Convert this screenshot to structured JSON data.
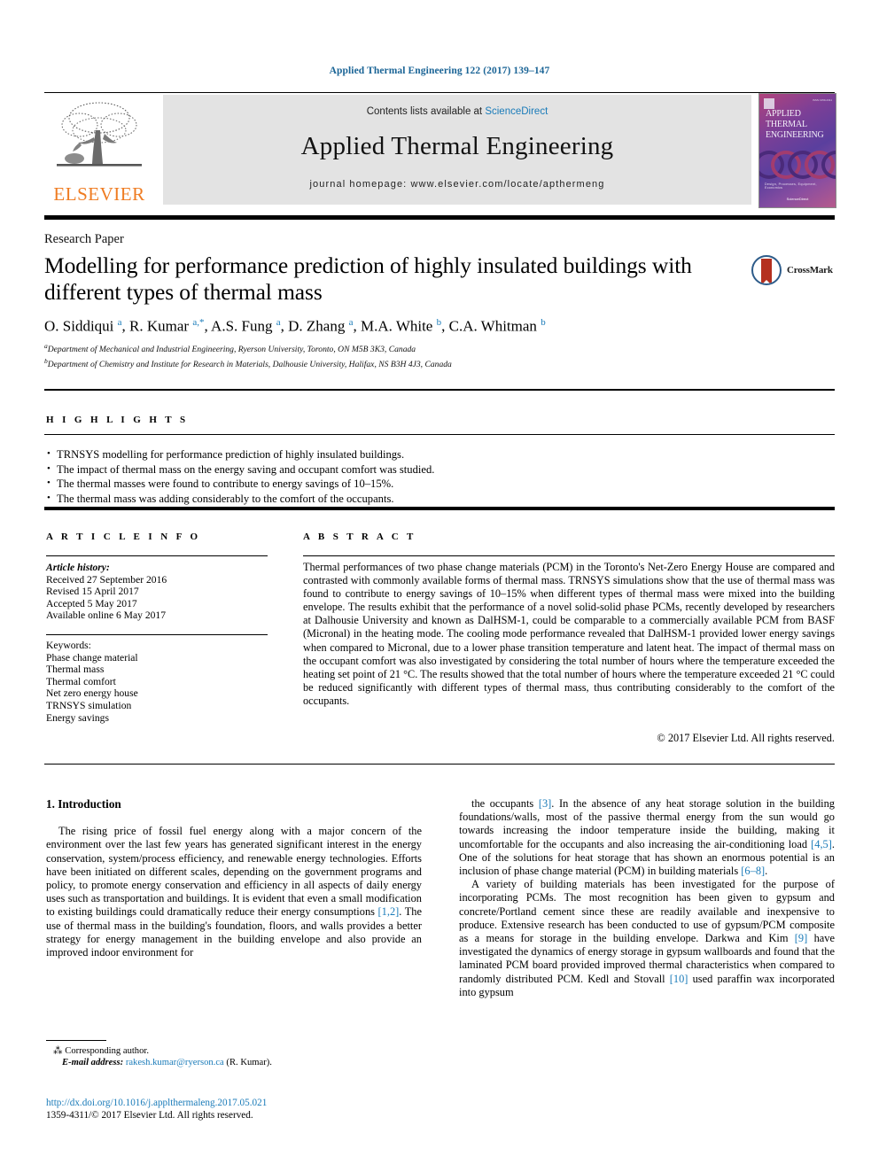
{
  "running_head": "Applied Thermal Engineering 122 (2017) 139–147",
  "masthead": {
    "publisher": "ELSEVIER",
    "contents_prefix": "Contents lists available at ",
    "contents_link": "ScienceDirect",
    "journal_title": "Applied Thermal Engineering",
    "homepage": "journal homepage: www.elsevier.com/locate/apthermeng",
    "cover": {
      "line1": "APPLIED",
      "line2": "THERMAL",
      "line3": "ENGINEERING",
      "footer_small": "Design, Processes, Equipment, Economics",
      "footer_brand": "ScienceDirect",
      "bg_start": "#b0437c",
      "bg_end": "#b65a8b"
    }
  },
  "article": {
    "kicker": "Research Paper",
    "title": "Modelling for performance prediction of highly insulated buildings with different types of thermal mass",
    "crossmark_label": "CrossMark",
    "authors_html": "O. Siddiqui <sup class=\"au-sup\">a</sup>, R. Kumar <sup class=\"au-sup\">a,*</sup>, A.S. Fung <sup class=\"au-sup\">a</sup>, D. Zhang <sup class=\"au-sup\">a</sup>, M.A. White <sup class=\"au-sup\">b</sup>, C.A. Whitman <sup class=\"au-sup\">b</sup>",
    "affiliations": [
      {
        "sup": "a",
        "text": "Department of Mechanical and Industrial Engineering, Ryerson University, Toronto, ON M5B 3K3, Canada"
      },
      {
        "sup": "b",
        "text": "Department of Chemistry and Institute for Research in Materials, Dalhousie University, Halifax, NS B3H 4J3, Canada"
      }
    ]
  },
  "highlights": {
    "label": "H I G H L I G H T S",
    "items": [
      "TRNSYS modelling for performance prediction of highly insulated buildings.",
      "The impact of thermal mass on the energy saving and occupant comfort was studied.",
      "The thermal masses were found to contribute to energy savings of 10–15%.",
      "The thermal mass was adding considerably to the comfort of the occupants."
    ]
  },
  "article_info": {
    "label": "A R T I C L E    I N F O",
    "history_label": "Article history:",
    "history": [
      "Received 27 September 2016",
      "Revised 15 April 2017",
      "Accepted 5 May 2017",
      "Available online 6 May 2017"
    ],
    "keywords_label": "Keywords:",
    "keywords": [
      "Phase change material",
      "Thermal mass",
      "Thermal comfort",
      "Net zero energy house",
      "TRNSYS simulation",
      "Energy savings"
    ]
  },
  "abstract": {
    "label": "A B S T R A C T",
    "text": "Thermal performances of two phase change materials (PCM) in the Toronto's Net-Zero Energy House are compared and contrasted with commonly available forms of thermal mass. TRNSYS simulations show that the use of thermal mass was found to contribute to energy savings of 10–15% when different types of thermal mass were mixed into the building envelope. The results exhibit that the performance of a novel solid-solid phase PCMs, recently developed by researchers at Dalhousie University and known as DalHSM-1, could be comparable to a commercially available PCM from BASF (Micronal) in the heating mode. The cooling mode performance revealed that DalHSM-1 provided lower energy savings when compared to Micronal, due to a lower phase transition temperature and latent heat. The impact of thermal mass on the occupant comfort was also investigated by considering the total number of hours where the temperature exceeded the heating set point of 21 °C. The results showed that the total number of hours where the temperature exceeded 21 °C could be reduced significantly with different types of thermal mass, thus contributing considerably to the comfort of the occupants.",
    "copyright": "© 2017 Elsevier Ltd. All rights reserved."
  },
  "body": {
    "section_heading": "1. Introduction",
    "left_paragraphs": [
      "The rising price of fossil fuel energy along with a major concern of the environment over the last few years has generated significant interest in the energy conservation, system/process efficiency, and renewable energy technologies. Efforts have been initiated on different scales, depending on the government programs and policy, to promote energy conservation and efficiency in all aspects of daily energy uses such as transportation and buildings. It is evident that even a small modification to existing buildings could dramatically reduce their energy consumptions [1,2]. The use of thermal mass in the building's foundation, floors, and walls provides a better strategy for energy management in the building envelope and also provide an improved indoor environment for"
    ],
    "right_paragraphs": [
      "the occupants [3]. In the absence of any heat storage solution in the building foundations/walls, most of the passive thermal energy from the sun would go towards increasing the indoor temperature inside the building, making it uncomfortable for the occupants and also increasing the air-conditioning load [4,5]. One of the solutions for heat storage that has shown an enormous potential is an inclusion of phase change material (PCM) in building materials [6–8].",
      "A variety of building materials has been investigated for the purpose of incorporating PCMs. The most recognition has been given to gypsum and concrete/Portland cement since these are readily available and inexpensive to produce. Extensive research has been conducted to use of gypsum/PCM composite as a means for storage in the building envelope. Darkwa and Kim [9] have investigated the dynamics of energy storage in gypsum wallboards and found that the laminated PCM board provided improved thermal characteristics when compared to randomly distributed PCM. Kedl and Stovall [10] used paraffin wax incorporated into gypsum"
    ]
  },
  "footnote": {
    "corresponding_marker": "⁂",
    "corresponding_text": "Corresponding author.",
    "email_label": "E-mail address:",
    "email": "rakesh.kumar@ryerson.ca",
    "email_owner": "(R. Kumar)."
  },
  "page_footer": {
    "doi": "http://dx.doi.org/10.1016/j.applthermaleng.2017.05.021",
    "issn_line": "1359-4311/© 2017 Elsevier Ltd. All rights reserved."
  },
  "colors": {
    "link": "#1a7bb9",
    "head_blue": "#1a6496",
    "elsevier_orange": "#ef7c22",
    "band_gray": "#e3e3e3"
  }
}
